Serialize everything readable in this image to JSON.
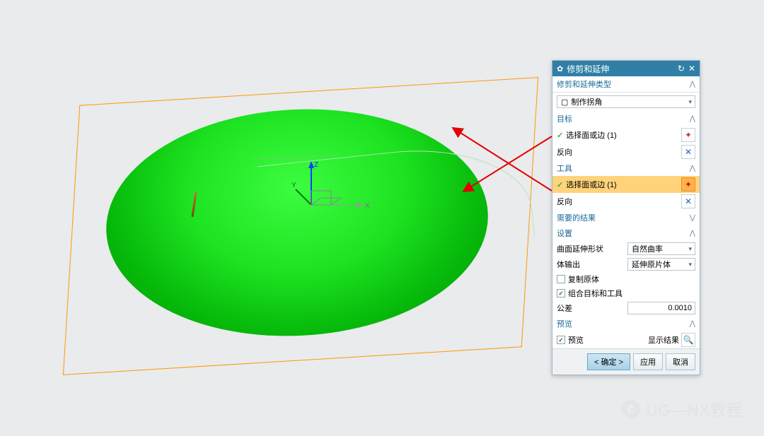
{
  "dialog": {
    "title": "修剪和延伸",
    "type_section": {
      "header": "修剪和延伸类型",
      "option": "制作拐角"
    },
    "target": {
      "header": "目标",
      "select_label": "选择面或边 (1)",
      "reverse_label": "反向"
    },
    "tool": {
      "header": "工具",
      "select_label": "选择面或边 (1)",
      "reverse_label": "反向"
    },
    "result": {
      "header": "需要的结果"
    },
    "settings": {
      "header": "设置",
      "extend_shape_label": "曲面延伸形状",
      "extend_shape_value": "自然曲率",
      "body_output_label": "体输出",
      "body_output_value": "延伸原片体",
      "copy_original": "复制原体",
      "group_tool": "组合目标和工具",
      "tolerance_label": "公差",
      "tolerance_value": "0.0010"
    },
    "preview": {
      "header": "预览",
      "checkbox": "预览",
      "show_result": "显示结果"
    },
    "buttons": {
      "ok": "< 确定 >",
      "apply": "应用",
      "cancel": "取消"
    }
  },
  "watermark": "UG—NX教程",
  "axes": {
    "x": "X",
    "y": "Y",
    "z": "Z"
  }
}
